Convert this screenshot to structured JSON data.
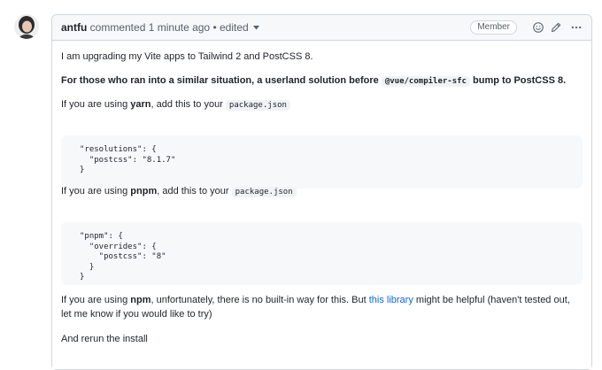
{
  "comment": {
    "author": "antfu",
    "action": "commented",
    "time": "1 minute ago",
    "separator": "•",
    "edited": "edited",
    "role_badge": "Member",
    "icons": [
      "smiley-icon",
      "pencil-icon",
      "kebab-horizontal-icon",
      "triangle-down-icon"
    ]
  },
  "body": {
    "p1": "I am upgrading my Vite apps to Tailwind 2 and PostCSS 8.",
    "p2_before": "For those who ran into a similar situation, a userland solution before",
    "p2_code": "@vue/compiler-sfc",
    "p2_after": "bump to PostCSS 8.",
    "p3_before": "If you are using ",
    "p3_bold": "yarn",
    "p3_mid": ", add this to your",
    "p3_code": "package.json",
    "code1": [
      "\"resolutions\": {",
      "  \"postcss\": \"8.1.7\"",
      "}"
    ],
    "p4_before": "If you are using ",
    "p4_bold": "pnpm",
    "p4_mid": ", add this to your",
    "p4_code": "package.json",
    "code2": [
      "\"pnpm\": {",
      "  \"overrides\": {",
      "    \"postcss\": \"8\"",
      "  }",
      "}"
    ],
    "p5_before": "If you are using ",
    "p5_bold": "npm",
    "p5_mid": ", unfortunately, there is no built-in way for this. But ",
    "p5_link": "this library",
    "p5_after": " might be helpful (haven't tested out, let me know if you would like to try)",
    "p6": "And rerun the install"
  },
  "colors": {
    "link": "#0969da",
    "border": "#d0d7de",
    "header_bg": "#f6f8fa",
    "code_bg": "#f6f8fa"
  }
}
